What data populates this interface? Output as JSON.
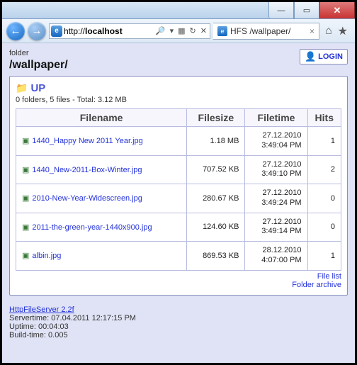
{
  "window": {
    "url_prefix": "http://",
    "url_host": "localhost",
    "tab_title": "HFS /wallpaper/",
    "tab_close": "×"
  },
  "page": {
    "crumb": "folder",
    "title": "/wallpaper/",
    "login_label": "LOGIN",
    "up_label": "UP",
    "stats": "0 folders, 5 files - Total: 3.12 MB",
    "headers": {
      "filename": "Filename",
      "filesize": "Filesize",
      "filetime": "Filetime",
      "hits": "Hits"
    },
    "files": [
      {
        "name": "1440_Happy New 2011 Year.jpg",
        "size": "1.18 MB",
        "date": "27.12.2010",
        "time": "3:49:04 PM",
        "hits": "1"
      },
      {
        "name": "1440_New-2011-Box-Winter.jpg",
        "size": "707.52 KB",
        "date": "27.12.2010",
        "time": "3:49:10 PM",
        "hits": "2"
      },
      {
        "name": "2010-New-Year-Widescreen.jpg",
        "size": "280.67 KB",
        "date": "27.12.2010",
        "time": "3:49:24 PM",
        "hits": "0"
      },
      {
        "name": "2011-the-green-year-1440x900.jpg",
        "size": "124.60 KB",
        "date": "27.12.2010",
        "time": "3:49:14 PM",
        "hits": "0"
      },
      {
        "name": "albin.jpg",
        "size": "869.53 KB",
        "date": "28.12.2010",
        "time": "4:07:00 PM",
        "hits": "1"
      }
    ],
    "link_filelist": "File list",
    "link_archive": "Folder archive"
  },
  "footer": {
    "server": "HttpFileServer 2.2f",
    "servertime_label": "Servertime: ",
    "servertime": "07.04.2011 12:17:15 PM",
    "uptime_label": "Uptime: ",
    "uptime": "00:04:03",
    "buildtime_label": "Build-time: ",
    "buildtime": "0.005"
  }
}
